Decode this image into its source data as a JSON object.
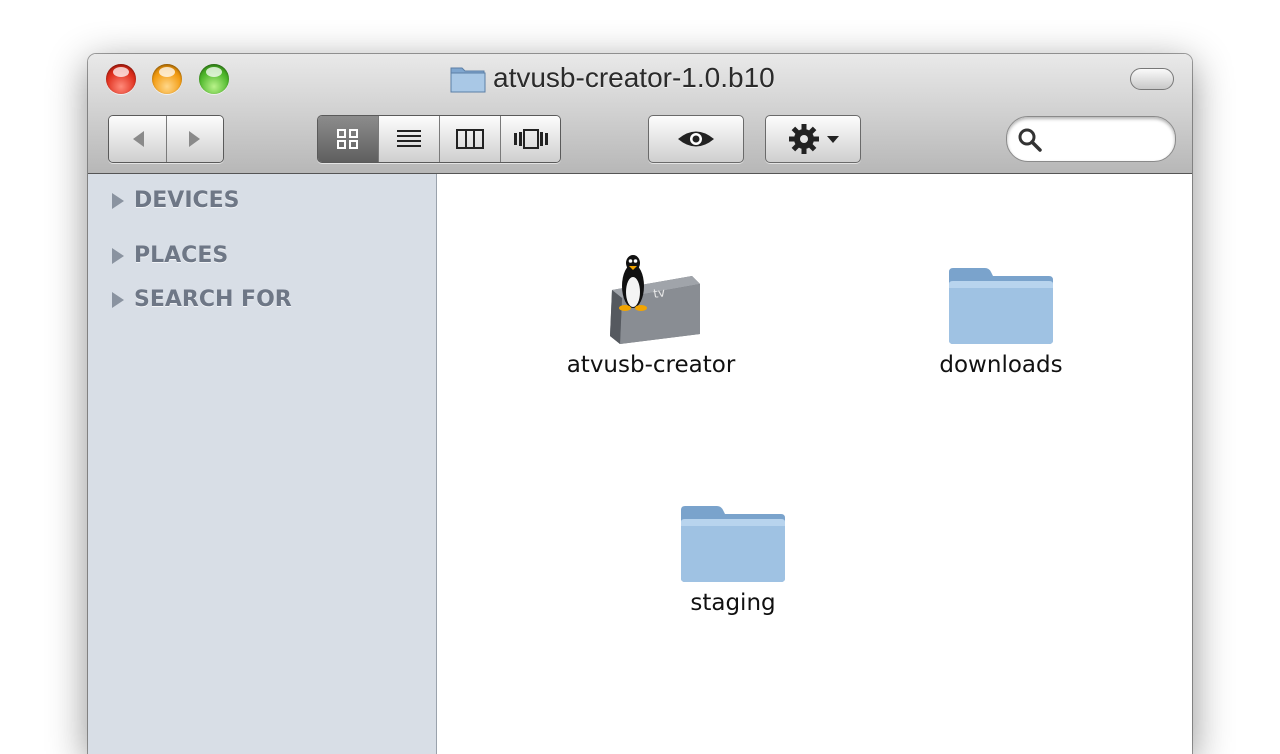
{
  "window": {
    "title": "atvusb-creator-1.0.b10"
  },
  "toolbar": {
    "view_modes": [
      "icon",
      "list",
      "column",
      "cover-flow"
    ],
    "active_view": "icon",
    "search": {
      "value": "",
      "placeholder": ""
    }
  },
  "sidebar": {
    "sections": [
      {
        "label": "DEVICES"
      },
      {
        "label": "PLACES"
      },
      {
        "label": "SEARCH FOR"
      }
    ]
  },
  "items": [
    {
      "label": "atvusb-creator",
      "icon": "apple-tv-linux-app-icon"
    },
    {
      "label": "downloads",
      "icon": "folder-icon"
    },
    {
      "label": "staging",
      "icon": "folder-icon"
    }
  ],
  "colors": {
    "sidebar_bg": "#d8dee6",
    "sidebar_text": "#6e7786",
    "folder_blue": "#8fb6dc"
  }
}
